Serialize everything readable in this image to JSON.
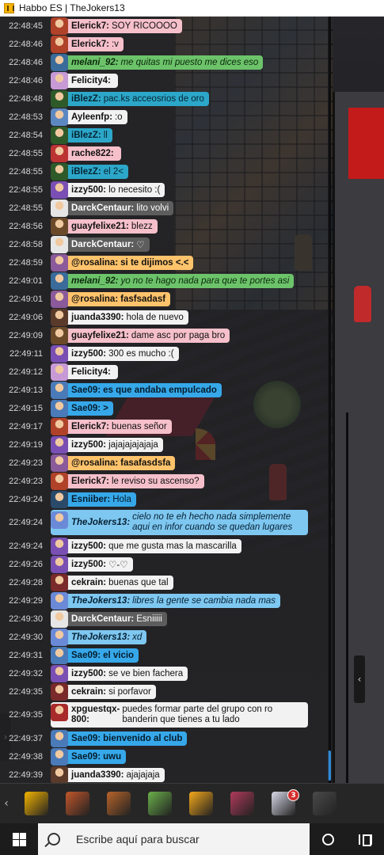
{
  "window": {
    "title": "Habbo ES | TheJokers13"
  },
  "colors": {
    "white": "#f2f2f2",
    "pink": "#f6c0cb",
    "green": "#6cc36a",
    "teal": "#2ca7c9",
    "blue": "#36a8ea",
    "orange": "#ffc36b",
    "gray": "#a9a9a9",
    "darkgray": "#5d5d5d",
    "lightblue": "#7ec7f0"
  },
  "chat": [
    {
      "time": "22:48:45",
      "user": "Elerick7:",
      "text": "SOY RICOOOO",
      "style": "pink",
      "avatar": "#b0422a"
    },
    {
      "time": "22:48:46",
      "user": "Elerick7:",
      "text": ":v",
      "style": "pink",
      "avatar": "#b0422a"
    },
    {
      "time": "22:48:46",
      "user": "melani_92:",
      "text": "me quitas mi puesto me dices eso",
      "style": "green",
      "italic": true,
      "avatar": "#3a6b9a"
    },
    {
      "time": "22:48:46",
      "user": "Felicity4:",
      "text": "",
      "style": "white",
      "avatar": "#c79ad6"
    },
    {
      "time": "22:48:48",
      "user": "iBlezZ:",
      "text": "pac.ks acceosrios de oro",
      "style": "teal",
      "avatar": "#2e5a2a"
    },
    {
      "time": "22:48:53",
      "user": "Ayleenfp:",
      "text": ":o",
      "style": "white",
      "avatar": "#5c88c2"
    },
    {
      "time": "22:48:54",
      "user": "iBlezZ:",
      "text": "ll",
      "style": "teal",
      "avatar": "#2e5a2a"
    },
    {
      "time": "22:48:55",
      "user": "rache822:",
      "text": "",
      "style": "pink",
      "avatar": "#b33"
    },
    {
      "time": "22:48:55",
      "user": "iBlezZ:",
      "text": "el 2<",
      "style": "teal",
      "avatar": "#2e5a2a"
    },
    {
      "time": "22:48:55",
      "user": "izzy500:",
      "text": "lo necesito  :(",
      "style": "white",
      "avatar": "#7a4fb3"
    },
    {
      "time": "22:48:55",
      "user": "DarckCentaur:",
      "text": "lito volvi",
      "style": "darkgray",
      "avatar": "#e6e6e6"
    },
    {
      "time": "22:48:56",
      "user": "guayfelixe21:",
      "text": "blezz",
      "style": "pink",
      "avatar": "#6b4a2a"
    },
    {
      "time": "22:48:58",
      "user": "DarckCentaur:",
      "text": "♡",
      "style": "darkgray",
      "avatar": "#e6e6e6"
    },
    {
      "time": "22:48:59",
      "user": "@rosalina:",
      "text": "si te dijimos <.<",
      "style": "orange",
      "bold": true,
      "avatar": "#8a5a9a"
    },
    {
      "time": "22:49:01",
      "user": "melani_92:",
      "text": "yo no te hago nada para que te portes asi",
      "style": "green",
      "italic": true,
      "avatar": "#3a6b9a"
    },
    {
      "time": "22:49:01",
      "user": "@rosalina:",
      "text": "fasfsadasf",
      "style": "orange",
      "bold": true,
      "avatar": "#8a5a9a"
    },
    {
      "time": "22:49:06",
      "user": "juanda3390:",
      "text": "hola de nuevo",
      "style": "white",
      "avatar": "#5a3a2a"
    },
    {
      "time": "22:49:09",
      "user": "guayfelixe21:",
      "text": "dame asc por paga bro",
      "style": "pink",
      "avatar": "#6b4a2a"
    },
    {
      "time": "22:49:11",
      "user": "izzy500:",
      "text": "300  es mucho :(",
      "style": "white",
      "avatar": "#7a4fb3"
    },
    {
      "time": "22:49:12",
      "user": "Felicity4:",
      "text": "",
      "style": "white",
      "avatar": "#c79ad6"
    },
    {
      "time": "22:49:13",
      "user": "Sae09:",
      "text": "es que andaba empulcado",
      "style": "blue",
      "bold": true,
      "avatar": "#4a7ab8"
    },
    {
      "time": "22:49:15",
      "user": "Sae09:",
      "text": ">",
      "style": "blue",
      "bold": true,
      "avatar": "#4a7ab8"
    },
    {
      "time": "22:49:17",
      "user": "Elerick7:",
      "text": "buenas señor",
      "style": "pink",
      "avatar": "#b0422a"
    },
    {
      "time": "22:49:19",
      "user": "izzy500:",
      "text": "jajajajajajaja",
      "style": "white",
      "avatar": "#7a4fb3"
    },
    {
      "time": "22:49:23",
      "user": "@rosalina:",
      "text": "fasafasdsfa",
      "style": "orange",
      "bold": true,
      "avatar": "#8a5a9a"
    },
    {
      "time": "22:49:23",
      "user": "Elerick7:",
      "text": "le reviso su ascenso?",
      "style": "pink",
      "avatar": "#b0422a"
    },
    {
      "time": "22:49:24",
      "user": "Esniiber:",
      "text": "Hola",
      "style": "blue",
      "avatar": "#2a4a6a"
    },
    {
      "time": "22:49:24",
      "user": "TheJokers13:",
      "text": "cielo no te eh hecho nada simplemente aqui en infor cuando se quedan lugares",
      "style": "lightblue",
      "italic": true,
      "tall": true,
      "avatar": "#6a8ad8"
    },
    {
      "time": "22:49:24",
      "user": "izzy500:",
      "text": "que me gusta mas la mascarilla",
      "style": "white",
      "avatar": "#7a4fb3"
    },
    {
      "time": "22:49:26",
      "user": "izzy500:",
      "text": "♡-♡",
      "style": "white",
      "avatar": "#7a4fb3"
    },
    {
      "time": "22:49:28",
      "user": "cekrain:",
      "text": "buenas que tal",
      "style": "white",
      "avatar": "#7a2a2a"
    },
    {
      "time": "22:49:29",
      "user": "TheJokers13:",
      "text": "libres la gente se cambia nada mas",
      "style": "lightblue",
      "italic": true,
      "avatar": "#6a8ad8"
    },
    {
      "time": "22:49:30",
      "user": "DarckCentaur:",
      "text": "Esniiiii",
      "style": "darkgray",
      "avatar": "#e6e6e6"
    },
    {
      "time": "22:49:30",
      "user": "TheJokers13:",
      "text": "xd",
      "style": "lightblue",
      "italic": true,
      "avatar": "#6a8ad8"
    },
    {
      "time": "22:49:31",
      "user": "Sae09:",
      "text": "el vicio",
      "style": "blue",
      "bold": true,
      "avatar": "#4a7ab8"
    },
    {
      "time": "22:49:32",
      "user": "izzy500:",
      "text": "se ve bien fachera",
      "style": "white",
      "avatar": "#7a4fb3"
    },
    {
      "time": "22:49:35",
      "user": "cekrain:",
      "text": "si porfavor",
      "style": "white",
      "avatar": "#7a2a2a"
    },
    {
      "time": "22:49:35",
      "user": "xpguestqx-800:",
      "text": "puedes formar parte del grupo con ro banderin que tienes a tu lado",
      "style": "white",
      "tall": true,
      "avatar": "#a82a2a"
    },
    {
      "time": "22:49:37",
      "user": "Sae09:",
      "text": "bienvenido al club",
      "style": "blue",
      "bold": true,
      "avatar": "#4a7ab8"
    },
    {
      "time": "22:49:38",
      "user": "Sae09:",
      "text": "uwu",
      "style": "blue",
      "bold": true,
      "avatar": "#4a7ab8"
    },
    {
      "time": "22:49:39",
      "user": "juanda3390:",
      "text": "ajajajaja",
      "style": "white",
      "avatar": "#5a3a2a"
    }
  ],
  "toolbar": {
    "collapse_label": "‹",
    "items": [
      {
        "name": "habbo-home-icon",
        "color": "#f4b400"
      },
      {
        "name": "rooms-icon",
        "color": "#c2562a"
      },
      {
        "name": "avatar-icon",
        "color": "#b8642a"
      },
      {
        "name": "shop-cart-icon",
        "color": "#6ab04a"
      },
      {
        "name": "builder-helmet-icon",
        "color": "#f4a81a"
      },
      {
        "name": "inventory-icon",
        "color": "#b03a5a"
      },
      {
        "name": "messenger-icon",
        "color": "#d8d8e8",
        "badge": "3"
      },
      {
        "name": "camera-icon",
        "color": "#4a4a4a"
      }
    ]
  },
  "taskbar": {
    "search_placeholder": "Escribe aquí para buscar"
  },
  "side_arrows": {
    "left": "›",
    "right": "‹"
  }
}
